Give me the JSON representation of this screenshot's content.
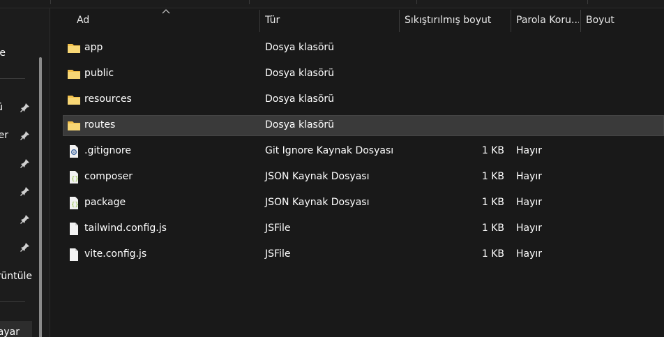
{
  "nav": {
    "items": [
      {
        "label": "e",
        "pinned": false
      },
      {
        "label": "ü",
        "pinned": true
      },
      {
        "label": "er",
        "pinned": true
      },
      {
        "label": "",
        "pinned": true
      },
      {
        "label": "",
        "pinned": true
      },
      {
        "label": "",
        "pinned": true
      },
      {
        "label": "",
        "pinned": true
      },
      {
        "label": "rüntüle",
        "pinned": false
      },
      {
        "label": "ayar",
        "pinned": false
      }
    ]
  },
  "columns": {
    "name": "Ad",
    "type": "Tür",
    "compressed_size": "Sıkıştırılmış boyut",
    "password": "Parola Koru...",
    "size": "Boyut"
  },
  "files": [
    {
      "name": "app",
      "type": "Dosya klasörü",
      "compressed": "",
      "password": "",
      "icon": "folder-icon",
      "selected": false
    },
    {
      "name": "public",
      "type": "Dosya klasörü",
      "compressed": "",
      "password": "",
      "icon": "folder-icon",
      "selected": false
    },
    {
      "name": "resources",
      "type": "Dosya klasörü",
      "compressed": "",
      "password": "",
      "icon": "folder-icon",
      "selected": false
    },
    {
      "name": "routes",
      "type": "Dosya klasörü",
      "compressed": "",
      "password": "",
      "icon": "folder-icon",
      "selected": true
    },
    {
      "name": ".gitignore",
      "type": "Git Ignore Kaynak Dosyası",
      "compressed": "1 KB",
      "password": "Hayır",
      "icon": "gear-file-icon",
      "selected": false
    },
    {
      "name": "composer",
      "type": "JSON Kaynak Dosyası",
      "compressed": "1 KB",
      "password": "Hayır",
      "icon": "json-file-icon",
      "selected": false
    },
    {
      "name": "package",
      "type": "JSON Kaynak Dosyası",
      "compressed": "1 KB",
      "password": "Hayır",
      "icon": "json-file-icon",
      "selected": false
    },
    {
      "name": "tailwind.config.js",
      "type": "JSFile",
      "compressed": "1 KB",
      "password": "Hayır",
      "icon": "blank-file-icon",
      "selected": false
    },
    {
      "name": "vite.config.js",
      "type": "JSFile",
      "compressed": "1 KB",
      "password": "Hayır",
      "icon": "blank-file-icon",
      "selected": false
    }
  ],
  "colors": {
    "background": "#191919",
    "selected_row": "#3a3a3a",
    "folder": "#f3c14b",
    "json_accent": "#8fbf3a"
  }
}
